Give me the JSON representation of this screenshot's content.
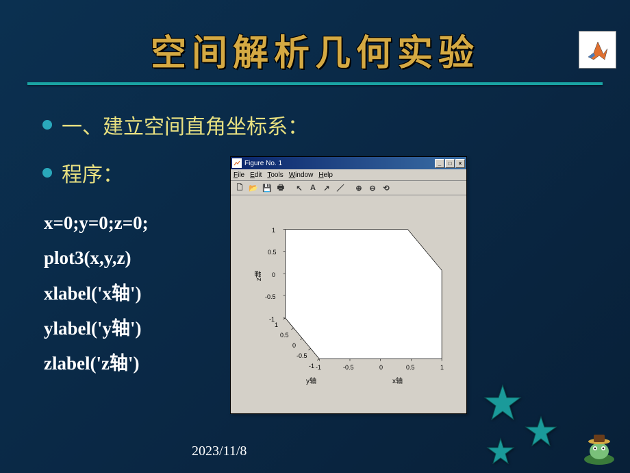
{
  "slide": {
    "title": "空间解析几何实验",
    "bullets": [
      "一、建立空间直角坐标系：",
      "程序："
    ],
    "code": [
      "x=0;y=0;z=0;",
      "plot3(x,y,z)",
      "xlabel('x轴')",
      "ylabel('y轴')",
      "zlabel('z轴')"
    ],
    "date": "2023/11/8"
  },
  "figure": {
    "title": "Figure No. 1",
    "menus": [
      "File",
      "Edit",
      "Tools",
      "Window",
      "Help"
    ],
    "toolbar_icons": [
      "new",
      "open",
      "save",
      "print",
      "sep",
      "arrow",
      "text-A",
      "slash-A",
      "slash",
      "sep",
      "zoom-in",
      "zoom-out",
      "rotate"
    ],
    "z_ticks": [
      "1",
      "0.5",
      "0",
      "-0.5",
      "-1"
    ],
    "y_ticks": [
      "1",
      "0.5",
      "0",
      "-0.5",
      "-1"
    ],
    "x_ticks": [
      "-1",
      "-0.5",
      "0",
      "0.5",
      "1"
    ],
    "xlabel": "x轴",
    "ylabel": "y轴",
    "zlabel": "z轴"
  },
  "chart_data": {
    "type": "scatter",
    "title": "",
    "xlabel": "x轴",
    "ylabel": "y轴",
    "zlabel": "z轴",
    "xlim": [
      -1,
      1
    ],
    "ylim": [
      -1,
      1
    ],
    "zlim": [
      -1,
      1
    ],
    "x": [
      0
    ],
    "y": [
      0
    ],
    "z": [
      0
    ],
    "note": "3D axes box drawn by plot3 for a single origin point"
  }
}
